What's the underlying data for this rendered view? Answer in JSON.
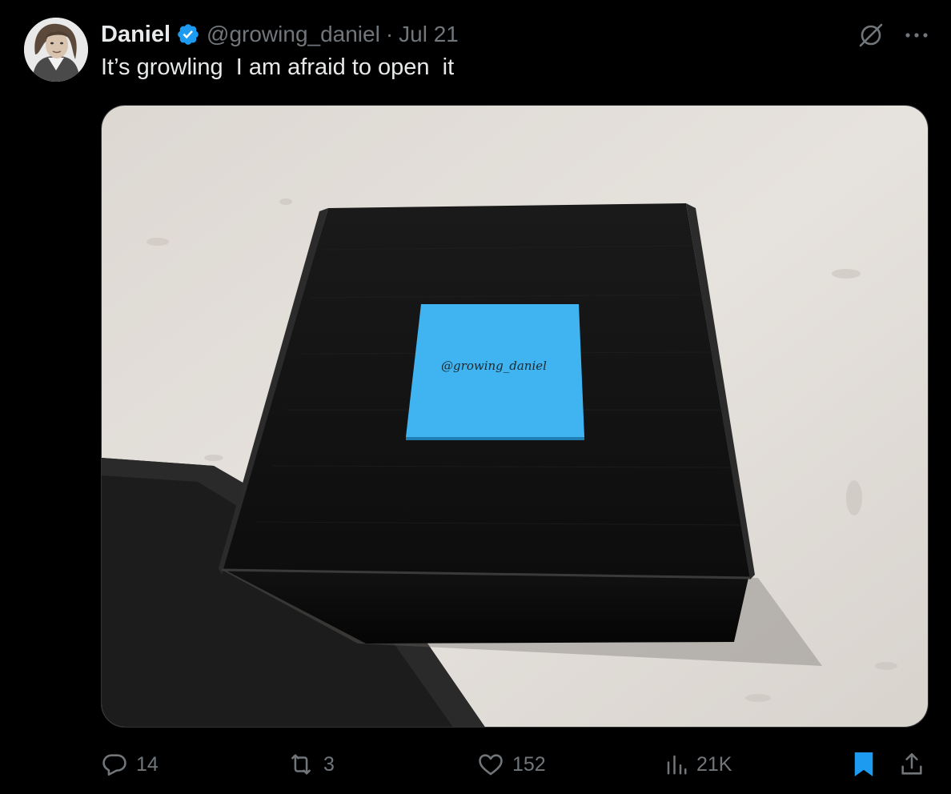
{
  "author": {
    "name": "Daniel",
    "handle": "@growing_daniel",
    "separator": "·",
    "date": "Jul 21",
    "verified": true,
    "verified_color": "#1d9bf0"
  },
  "tweet": {
    "text": "It’s growling  I am afraid to open  it"
  },
  "media": {
    "sticky_note_text": "@growing_daniel",
    "sticky_note_color": "#3fb4f0"
  },
  "top_actions": {
    "icons": [
      "grok-icon",
      "more-icon"
    ]
  },
  "engagement": {
    "replies": "14",
    "reposts": "3",
    "likes": "152",
    "views": "21K",
    "bookmark_active_color": "#1d9bf0"
  },
  "colors": {
    "background": "#000000",
    "text": "#e7e9ea",
    "muted": "#71767b",
    "accent": "#1d9bf0"
  }
}
